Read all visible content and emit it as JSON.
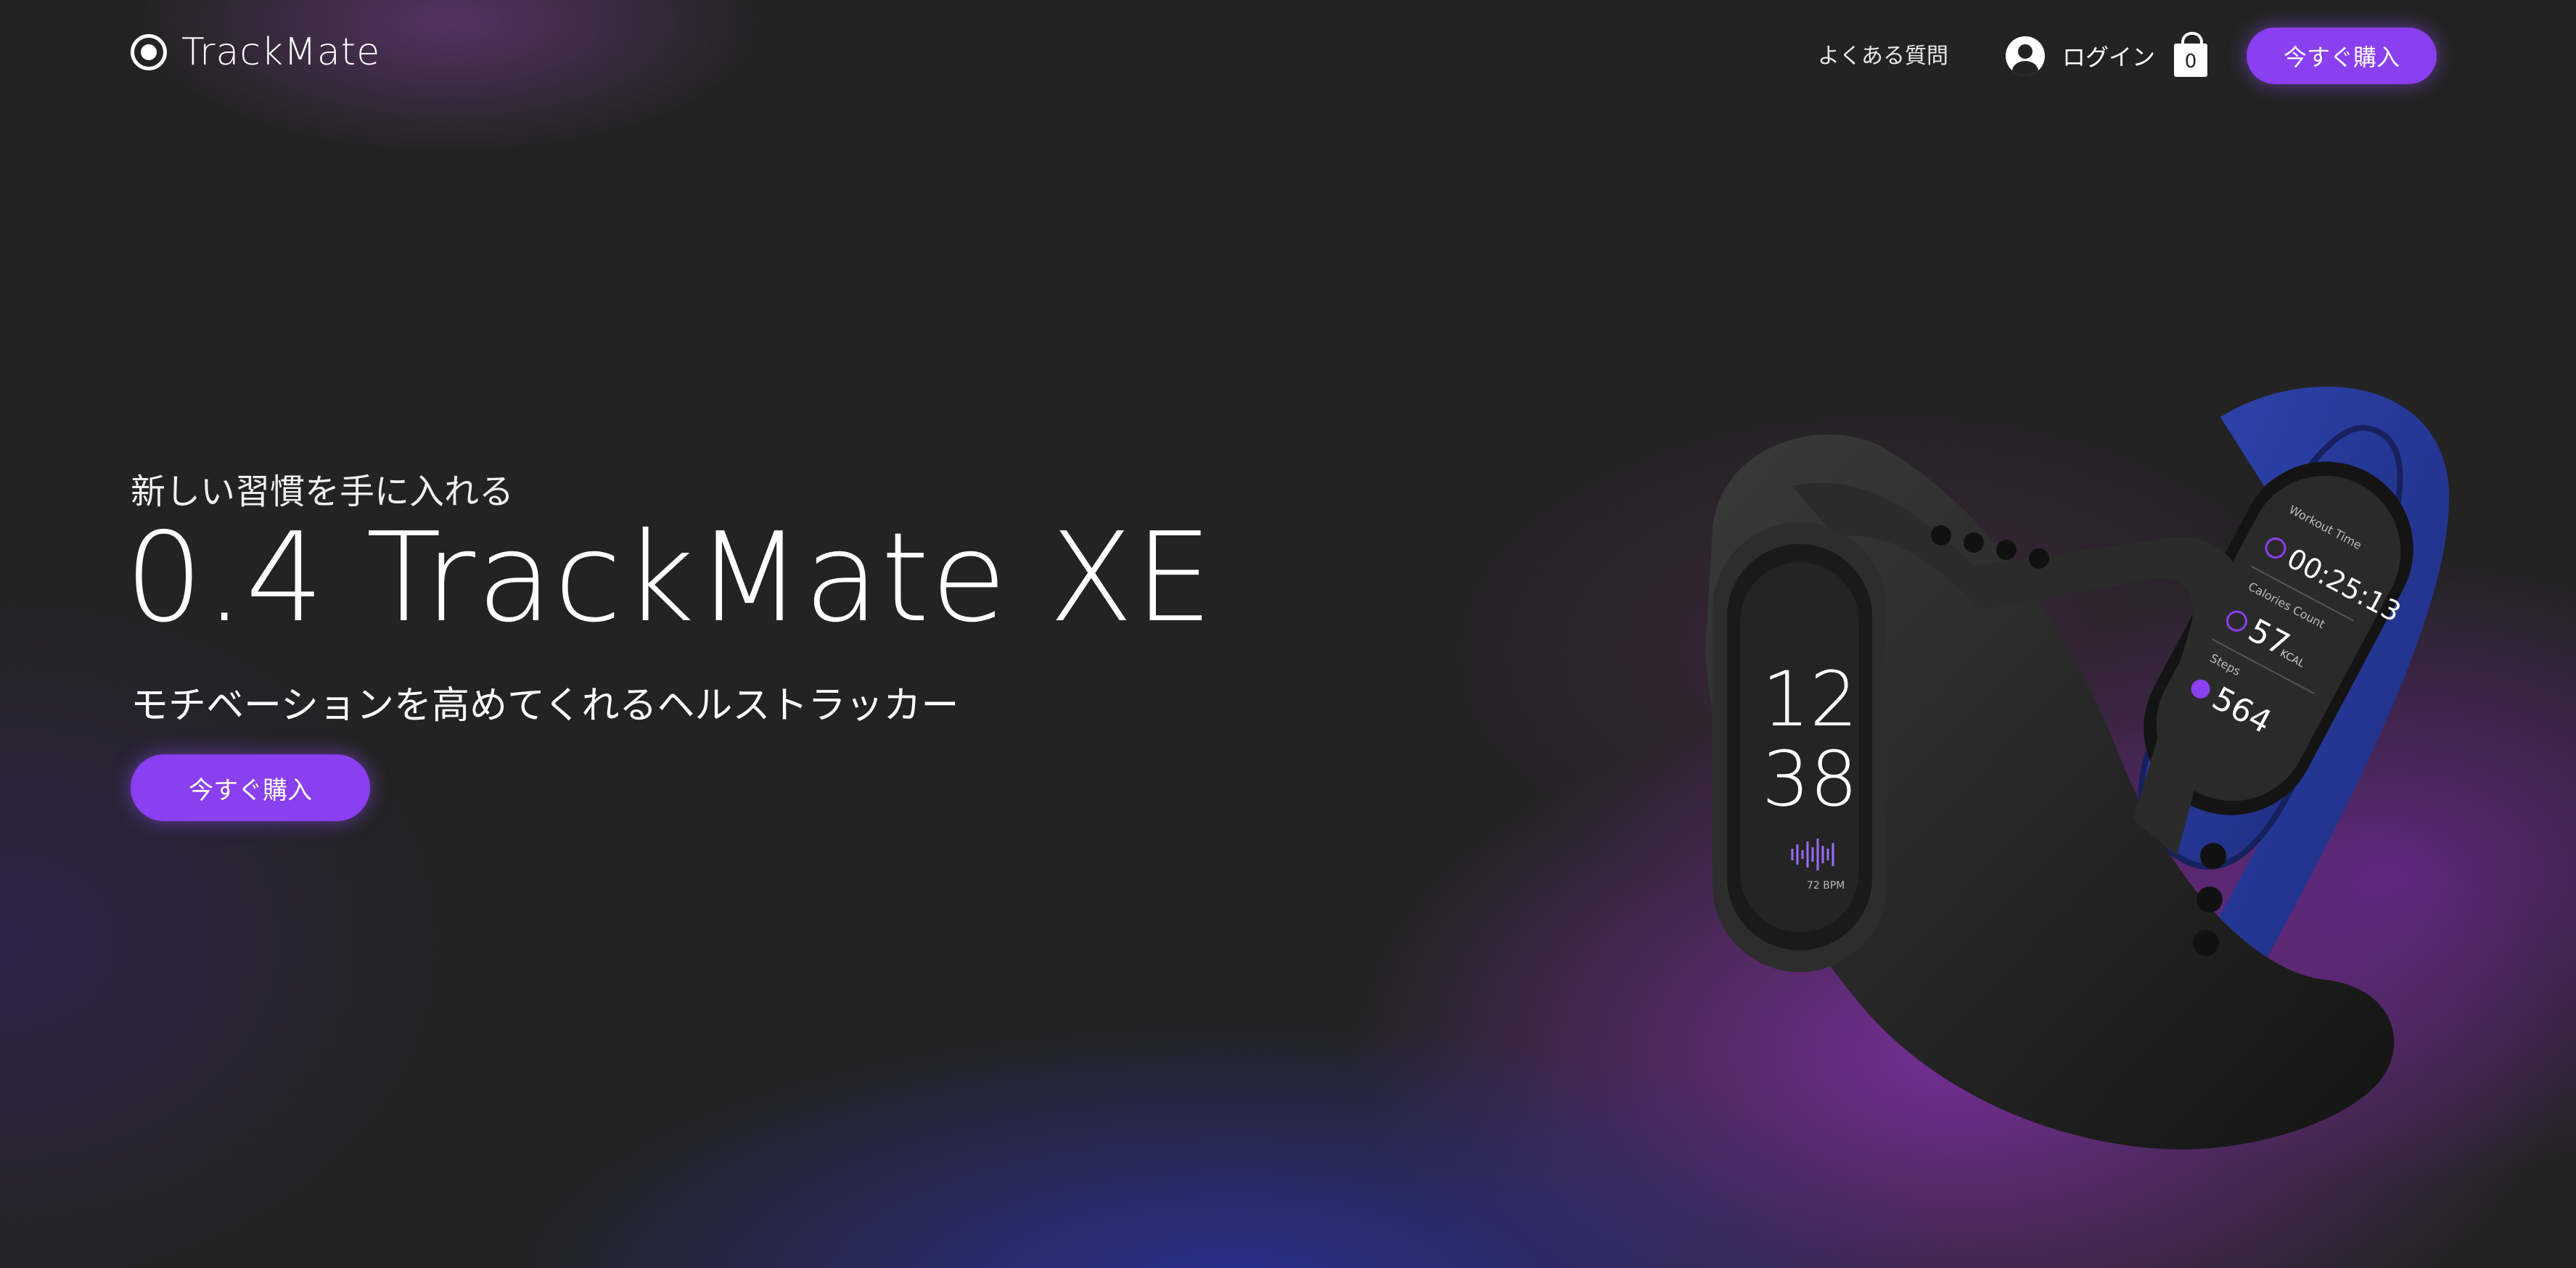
{
  "brand": {
    "name": "TrackMate",
    "logo_icon": "target-circle-icon"
  },
  "nav": {
    "faq_label": "よくある質問",
    "login_label": "ログイン",
    "cart_count": "0",
    "buy_label": "今すぐ購入"
  },
  "hero": {
    "tagline": "新しい習慣を手に入れる",
    "title": "0.4 TrackMate XE",
    "subtitle": "モチベーションを高めてくれるヘルストラッカー",
    "cta_label": "今すぐ購入"
  },
  "product_screens": {
    "black_band": {
      "hour": "12",
      "minute": "38",
      "bpm": "72 BPM"
    },
    "blue_band": {
      "workout_label": "Workout Time",
      "workout_value": "00:25:13",
      "calories_label": "Calories Count",
      "calories_value": "57",
      "calories_unit": "KCAL",
      "steps_label": "Steps",
      "steps_value": "564"
    }
  },
  "colors": {
    "accent": "#8a3ff0",
    "background": "#232323",
    "blue_band": "#23348f"
  }
}
